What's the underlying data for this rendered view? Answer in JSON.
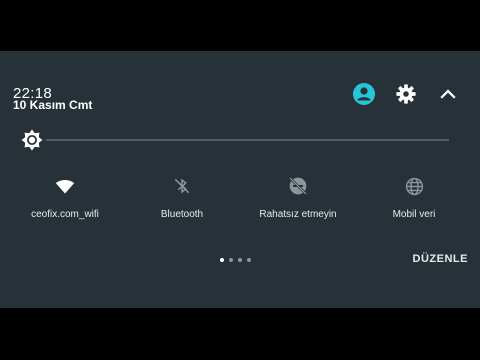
{
  "header": {
    "time": "22:18",
    "date": "10 Kasım Cmt"
  },
  "icons": {
    "user": "account-circle-icon",
    "settings": "gear-icon",
    "collapse": "chevron-up-icon"
  },
  "colors": {
    "accent": "#26c6da",
    "panel": "#263238"
  },
  "tiles": [
    {
      "label": "ceofix.com_wifi",
      "icon": "wifi-icon"
    },
    {
      "label": "Bluetooth",
      "icon": "bluetooth-off-icon"
    },
    {
      "label": "Rahatsız etmeyin",
      "icon": "do-not-disturb-off-icon"
    },
    {
      "label": "Mobil veri",
      "icon": "globe-icon"
    }
  ],
  "pager": {
    "pages": 4,
    "active": 1
  },
  "edit_label": "DÜZENLE"
}
